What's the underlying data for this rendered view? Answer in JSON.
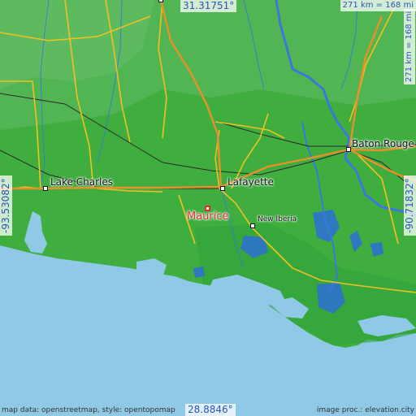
{
  "map": {
    "colors": {
      "land": "#3fae3f",
      "land_high": "#57b558",
      "water": "#8fc9e6",
      "marsh_water": "#2d6fd6",
      "highway": "#f0c020",
      "interstate": "#e8902a",
      "railway": "#2a2a2a",
      "river": "#3b78d8",
      "highlight": "#e03030"
    },
    "coordinates": {
      "top": "31.31751°",
      "bottom": "28.8846°",
      "left": "-93.53082°",
      "right": "-90.71832°"
    },
    "scale": {
      "horizontal": "271 km = 168 mi",
      "vertical": "271 km = 168 mi"
    },
    "cities": {
      "lake_charles": "Lake Charles",
      "lafayette": "Lafayette",
      "baton_rouge": "Baton Rouge",
      "new_iberia": "New Iberia"
    },
    "highlight": {
      "name": "Maurice"
    },
    "credits": {
      "left": "map data: openstreetmap, style: opentopomap",
      "right": "image proc.: elevation.city"
    }
  }
}
